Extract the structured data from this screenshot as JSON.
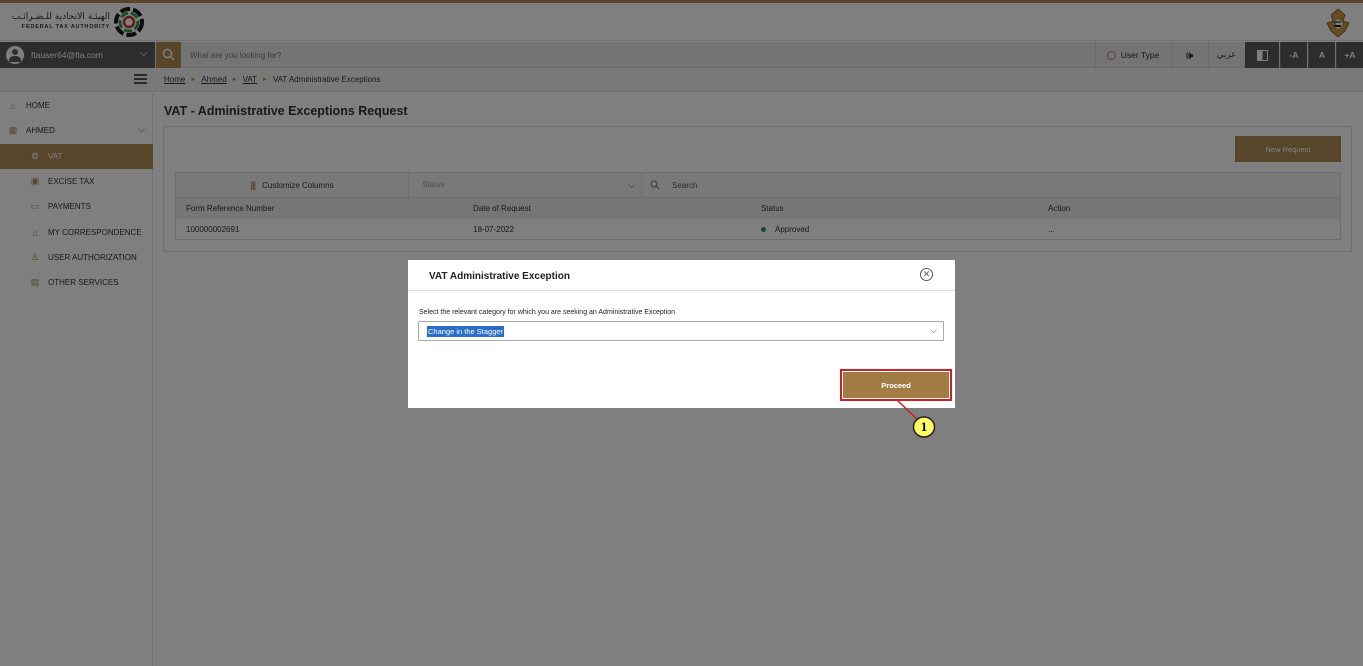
{
  "header": {
    "logo_ar": "الهيئـة الاتحادية للـضـرائـب",
    "logo_en": "FEDERAL TAX AUTHORITY",
    "emblem_icon": "uae-emblem-icon"
  },
  "toolbar": {
    "user_email": "ftauser64@fta.com",
    "search_placeholder": "What are you looking for?",
    "user_type_label": "User Type",
    "speaker_icon": "speaker-icon",
    "speaker_glyph": "🕪",
    "language_label": "عربي",
    "font_minus": "-A",
    "font_normal": "A",
    "font_plus": "+A"
  },
  "breadcrumb": {
    "items": [
      "Home",
      "Ahmed",
      "VAT",
      "VAT Administrative Exceptions"
    ],
    "separator": "►"
  },
  "sidebar": {
    "items": [
      {
        "label": "HOME",
        "icon": "home-icon",
        "glyph": "⌂"
      },
      {
        "label": "AHMED",
        "icon": "grid-icon",
        "glyph": "▦"
      },
      {
        "label": "VAT",
        "icon": "vat-icon",
        "glyph": "⚙"
      },
      {
        "label": "EXCISE TAX",
        "icon": "excise-icon",
        "glyph": "▣"
      },
      {
        "label": "PAYMENTS",
        "icon": "payments-icon",
        "glyph": "▭"
      },
      {
        "label": "MY CORRESPONDENCE",
        "icon": "correspondence-icon",
        "glyph": "⌂"
      },
      {
        "label": "USER AUTHORIZATION",
        "icon": "user-auth-icon",
        "glyph": "♙"
      },
      {
        "label": "OTHER SERVICES",
        "icon": "services-icon",
        "glyph": "▤"
      }
    ],
    "chevron": "⌵"
  },
  "main": {
    "page_title": "VAT - Administrative Exceptions Request",
    "new_request_label": "New Request",
    "customize_columns_label": "Customize Columns",
    "customize_glyph": "|||",
    "status_placeholder": "Status",
    "search_label": "Search",
    "table": {
      "columns": [
        "Form Reference Number",
        "Date of Request",
        "Status",
        "Action"
      ],
      "rows": [
        {
          "ref": "100000002691",
          "date": "18-07-2022",
          "status": "Approved",
          "action": "..."
        }
      ]
    }
  },
  "modal": {
    "title": "VAT Administrative Exception",
    "close_glyph": "✕",
    "category_label": "Select the relevant category for which you are seeking an Administrative Exception",
    "selected_category": "Change in the Stagger",
    "proceed_label": "Proceed",
    "callout_number": "1"
  },
  "colors": {
    "accent": "#b08d57",
    "approved": "#2e9c53",
    "highlight": "#d21e1e",
    "callout_fill": "#ffff66"
  }
}
